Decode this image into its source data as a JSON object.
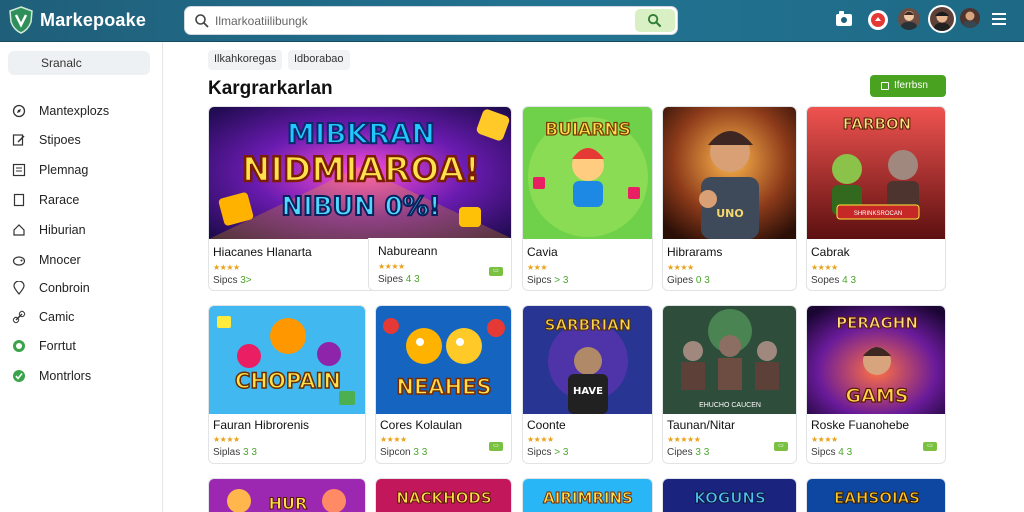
{
  "app": {
    "brand": "Markepoake"
  },
  "search": {
    "placeholder": "Ilmarkoatiilibungk"
  },
  "sidebar": {
    "search_label": "Sranalc",
    "items": [
      {
        "label": "Mantexplozs",
        "icon": "compass-icon"
      },
      {
        "label": "Stipoes",
        "icon": "edit-icon"
      },
      {
        "label": "Plemnag",
        "icon": "list-icon"
      },
      {
        "label": "Rarace",
        "icon": "bookmark-icon"
      },
      {
        "label": "Hiburian",
        "icon": "home-icon"
      },
      {
        "label": "Mnocer",
        "icon": "gamepad-icon"
      },
      {
        "label": "Conbroin",
        "icon": "location-icon"
      },
      {
        "label": "Camic",
        "icon": "link-icon"
      },
      {
        "label": "Forrtut",
        "icon": "green-circle-icon"
      },
      {
        "label": "Montrlors",
        "icon": "green-check-icon"
      }
    ]
  },
  "filters": {
    "chips": [
      "Ilkahkoregas",
      "Idborabao"
    ]
  },
  "main": {
    "heading": "Kargrarkarlan",
    "action_label": "Iferrbsn"
  },
  "cards": [
    {
      "title": "Hiacanes Hlanarta",
      "stars": "★★★★",
      "meta": "Sipcs ",
      "meta_tail": "3>",
      "badge": false,
      "art_text": [
        "MIBKRAN",
        "NIDMIAROA!",
        "NIBUN 0%!"
      ]
    },
    {
      "title": "Nabureann",
      "stars": "★★★★",
      "meta": "Sipes ",
      "meta_tail": "4 3",
      "badge": true,
      "art_text": []
    },
    {
      "title": "Cavia",
      "stars": "★★★",
      "meta": "Sipcs ",
      "meta_tail": "> 3",
      "badge": false,
      "art_text": [
        "BUIARNS"
      ]
    },
    {
      "title": "Hibrarams",
      "stars": "★★★★",
      "meta": "Gipes ",
      "meta_tail": "0 3",
      "badge": false,
      "art_text": [
        "UNO"
      ]
    },
    {
      "title": "Cabrak",
      "stars": "★★★★",
      "meta": "Sopes ",
      "meta_tail": "4 3",
      "badge": false,
      "art_text": [
        "FARBON",
        "SHRINKSROCAN"
      ]
    },
    {
      "title": "Fauran Hibrorenis",
      "stars": "★★★★",
      "meta": "Siplas ",
      "meta_tail": "3 3",
      "badge": false,
      "art_text": [
        "CHOPAIN"
      ]
    },
    {
      "title": "Cores Kolaulan",
      "stars": "★★★★",
      "meta": "Sipcon ",
      "meta_tail": "3 3",
      "badge": true,
      "art_text": [
        "NEAHES"
      ]
    },
    {
      "title": "Coonte",
      "stars": "★★★★",
      "meta": "Sipcs ",
      "meta_tail": "> 3",
      "badge": false,
      "art_text": [
        "SARBRIAN",
        "HAVE"
      ]
    },
    {
      "title": "Taunan/Nitar",
      "stars": "★★★★★",
      "meta": "Cipes ",
      "meta_tail": "3 3",
      "badge": true,
      "art_text": [
        "EHUCHO CAUCEN"
      ]
    },
    {
      "title": "Roske Fuanohebe",
      "stars": "★★★★",
      "meta": "Sipcs ",
      "meta_tail": "4 3",
      "badge": true,
      "art_text": [
        "PERAGHN",
        "GAMS"
      ]
    },
    {
      "title": "",
      "stars": "",
      "meta": "",
      "meta_tail": "",
      "badge": false,
      "art_text": [
        "HUR"
      ]
    },
    {
      "title": "",
      "stars": "",
      "meta": "",
      "meta_tail": "",
      "badge": false,
      "art_text": [
        "NACKHODS"
      ]
    },
    {
      "title": "",
      "stars": "",
      "meta": "",
      "meta_tail": "",
      "badge": false,
      "art_text": [
        "AIRIMRINS"
      ]
    },
    {
      "title": "",
      "stars": "",
      "meta": "",
      "meta_tail": "",
      "badge": false,
      "art_text": [
        "KOGUNS"
      ]
    },
    {
      "title": "",
      "stars": "",
      "meta": "",
      "meta_tail": "",
      "badge": false,
      "art_text": [
        "EAHSOIAS"
      ]
    }
  ],
  "colors": {
    "topbar": "#227392",
    "accent_green": "#49a321",
    "star": "#e9a21b"
  }
}
